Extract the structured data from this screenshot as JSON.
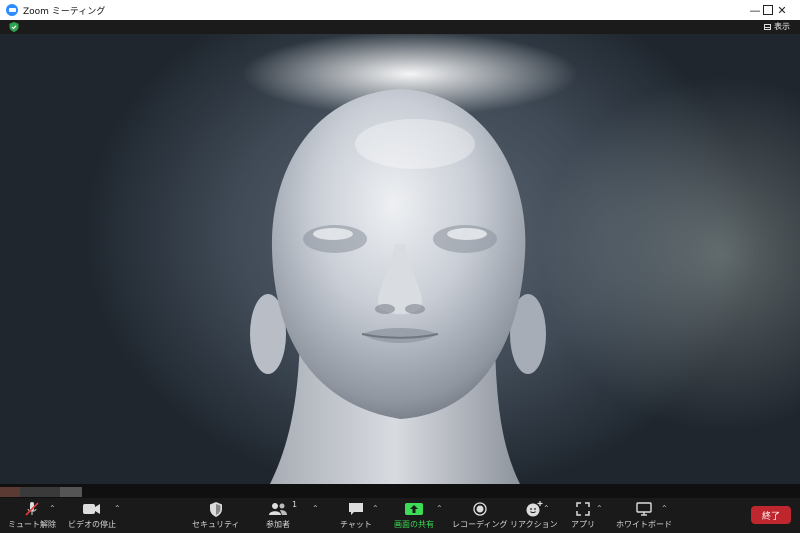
{
  "window": {
    "title": "Zoom ミーティング"
  },
  "top_bar": {
    "view_label": "表示"
  },
  "toolbar": {
    "unmute_label": "ミュート解除",
    "stop_video_label": "ビデオの停止",
    "security_label": "セキュリティ",
    "participants_label": "参加者",
    "participants_count": "1",
    "chat_label": "チャット",
    "share_screen_label": "画面の共有",
    "record_label": "レコーディング",
    "reactions_label": "リアクション",
    "apps_label": "アプリ",
    "whiteboard_label": "ホワイトボード",
    "end_label": "終了"
  },
  "colors": {
    "accent": "#2d8cff",
    "share_green": "#3ddc57",
    "end_red": "#c0262d",
    "shield_green": "#2ea44f"
  }
}
